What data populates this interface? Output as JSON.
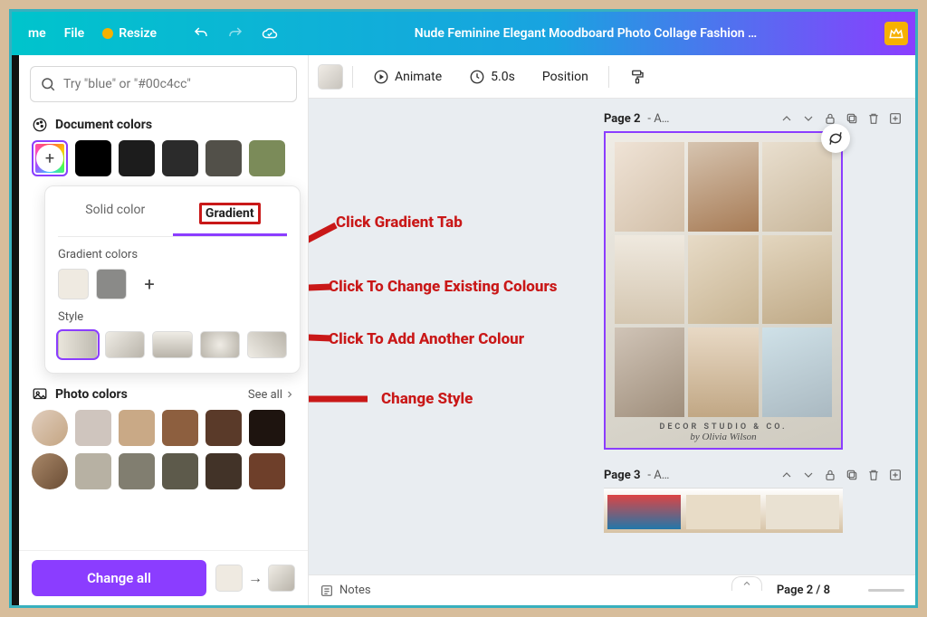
{
  "topbar": {
    "home": "me",
    "file": "File",
    "resize": "Resize",
    "title": "Nude Feminine Elegant Moodboard Photo Collage Fashion …"
  },
  "search": {
    "placeholder": "Try \"blue\" or \"#00c4cc\""
  },
  "sections": {
    "document_colors": "Document colors",
    "photo_colors": "Photo colors",
    "see_all": "See all"
  },
  "doc_swatches": [
    "#000000",
    "#1c1c1c",
    "#2b2b2b",
    "#525049",
    "#7b8b59"
  ],
  "popover": {
    "tab_solid": "Solid color",
    "tab_gradient": "Gradient",
    "gc_label": "Gradient colors",
    "style_label": "Style",
    "gc_colors": [
      "#efeae1",
      "#8a8a88"
    ],
    "style_gradients": [
      "linear-gradient(90deg,#e9e5db,#bfbbb1)",
      "linear-gradient(135deg,#efece5,#b9b4aa)",
      "linear-gradient(180deg,#efece5,#b9b4aa)",
      "radial-gradient(circle,#efece5,#b9b4aa)",
      "linear-gradient(45deg,#efece5,#b9b4aa)"
    ]
  },
  "photo_swatches_row1": [
    "#cfc5be",
    "#c9a986",
    "#8d5f3f",
    "#5a3a29",
    "#1e140f"
  ],
  "photo_swatches_row2": [
    "#b7b1a3",
    "#817e70",
    "#5d5a4b",
    "#423328",
    "#6e3f2a"
  ],
  "change_all": "Change all",
  "toolbar": {
    "animate": "Animate",
    "duration": "5.0s",
    "position": "Position"
  },
  "pages": {
    "p2_label": "Page 2",
    "p2_suffix": "- A…",
    "p3_label": "Page 3",
    "p3_suffix": "- A…",
    "counter": "Page 2 / 8",
    "caption1": "DECOR STUDIO & CO.",
    "caption2": "by Olivia Wilson"
  },
  "notes": "Notes",
  "page_thumbs": [
    "linear-gradient(140deg,#efe3d6,#d2bfa8)",
    "linear-gradient(160deg,#d6c4b0,#a77b55)",
    "linear-gradient(150deg,#e9dfcf,#c9b79b)",
    "linear-gradient(#efe9df,#d4c6b0)",
    "linear-gradient(150deg,#e7dbc7,#c7b391)",
    "linear-gradient(160deg,#e3d6bf,#bfa986)",
    "linear-gradient(150deg,#d0c4b7,#9f8e7b)",
    "linear-gradient(#e8d9c5,#c1a784)",
    "linear-gradient(160deg,#cfe1e8,#aab9c1)"
  ],
  "annotations": {
    "a1": "Click Gradient Tab",
    "a2": "Click To Change Existing Colours",
    "a3": "Click To Add Another Colour",
    "a4": "Change Style"
  }
}
